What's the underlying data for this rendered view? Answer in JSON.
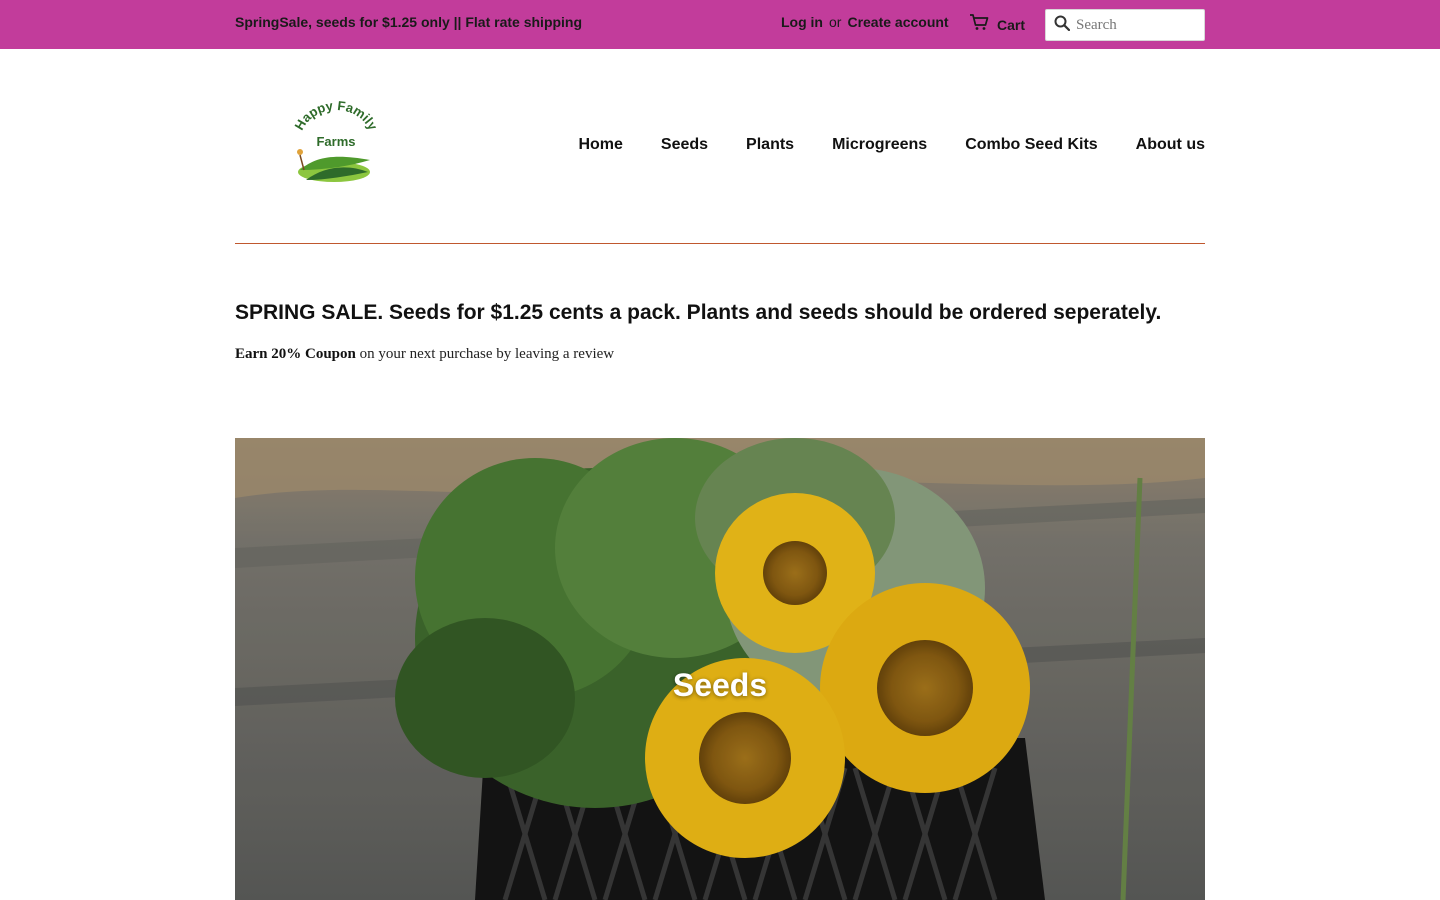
{
  "announcement": "SpringSale, seeds for $1.25 only || Flat rate shipping",
  "account": {
    "login": "Log in",
    "or": "or",
    "create": "Create account"
  },
  "cart": {
    "label": "Cart",
    "icon": "cart-icon"
  },
  "search": {
    "placeholder": "Search",
    "icon": "search-icon"
  },
  "logo": {
    "line1": "Happy Family",
    "line2": "Farms"
  },
  "nav": [
    "Home",
    "Seeds",
    "Plants",
    "Microgreens",
    "Combo Seed Kits",
    "About us"
  ],
  "headline": "SPRING SALE. Seeds for $1.25 cents a pack. Plants and seeds should be ordered seperately.",
  "subline": {
    "bold": "Earn 20% Coupon",
    "rest": " on your next purchase by leaving a review"
  },
  "hero": {
    "title": "Seeds"
  },
  "colors": {
    "topbar": "#c23c9b",
    "divider": "#c0582e",
    "logo_green": "#2e6b2a"
  }
}
